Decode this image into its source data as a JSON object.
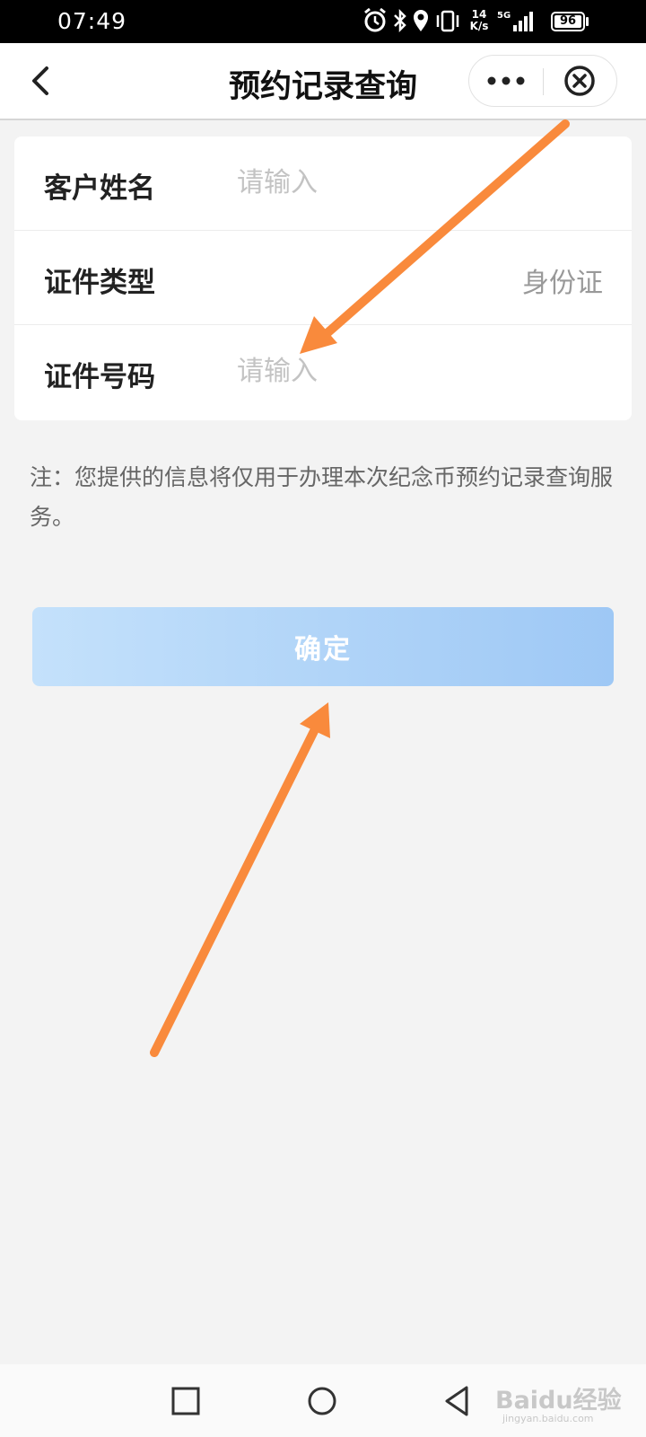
{
  "status_bar": {
    "time": "07:49",
    "net_speed_value": "14",
    "net_speed_unit": "K/s",
    "network": "5G",
    "battery_level": "96",
    "icons": [
      "alarm-icon",
      "bluetooth-icon",
      "location-icon",
      "vibrate-icon",
      "signal-icon",
      "battery-icon"
    ]
  },
  "nav": {
    "title": "预约记录查询",
    "back_icon": "chevron-left-icon",
    "more_icon": "more-dots-icon",
    "close_icon": "close-circle-icon"
  },
  "form": {
    "rows": [
      {
        "label": "客户姓名",
        "placeholder": "请输入"
      },
      {
        "label": "证件类型",
        "value": "身份证"
      },
      {
        "label": "证件号码",
        "placeholder": "请输入"
      }
    ]
  },
  "note": "注：您提供的信息将仅用于办理本次纪念币预约记录查询服务。",
  "confirm_label": "确定",
  "system_nav": {
    "icons": [
      "recent-apps-icon",
      "home-icon",
      "back-triangle-icon"
    ]
  },
  "watermark": {
    "text": "Baidu经验",
    "sub": "jingyan.baidu.com"
  },
  "colors": {
    "accent_button_start": "#c4e1fb",
    "accent_button_end": "#9ec8f5",
    "annotation_arrow": "#f98a3c",
    "background": "#f3f3f3"
  }
}
